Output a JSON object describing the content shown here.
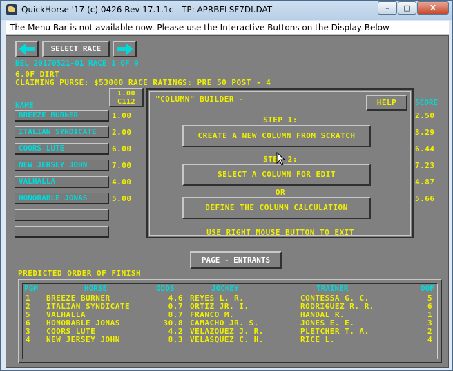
{
  "window": {
    "title": "QuickHorse '17 (c) 0426 Rev 17.1.1c - TP: APRBELSF7DI.DAT",
    "minimize_label": "–",
    "maximize_label": "□",
    "close_label": "X"
  },
  "menu_bar_text": "The Menu Bar is not available now.  Please use the Interactive Buttons on the Display Below",
  "nav": {
    "select_race_label": "SELECT RACE"
  },
  "race_info": {
    "line1": "BEL 20170521-01 RACE 1 OF 9",
    "line2": "6.0F DIRT",
    "line3": "CLAIMING PURSE: $53000  RACE RATINGS: PRE 50  POST - 4"
  },
  "column_header": {
    "top": "1.00",
    "bottom": "C112"
  },
  "name_header": "NAME",
  "score_header": "SCORE",
  "entrants": [
    {
      "name": "BREEZE BURNER",
      "value": "1.00",
      "score": "2.50"
    },
    {
      "name": "ITALIAN SYNDICATE",
      "value": "2.00",
      "score": "3.29"
    },
    {
      "name": "COORS LUTE",
      "value": "6.00",
      "score": "6.44"
    },
    {
      "name": "NEW JERSEY JOHN",
      "value": "7.00",
      "score": "7.23"
    },
    {
      "name": "VALHALLA",
      "value": "4.00",
      "score": "4.87"
    },
    {
      "name": "HONORABLE JONAS",
      "value": "5.00",
      "score": "5.66"
    }
  ],
  "builder": {
    "title": "\"COLUMN\" BUILDER -",
    "help_label": "HELP",
    "step1": "STEP 1:",
    "create_label": "CREATE A NEW COLUMN FROM SCRATCH",
    "step2": "STEP 2:",
    "select_label": "SELECT A COLUMN FOR EDIT",
    "or_label": "OR",
    "define_label": "DEFINE THE COLUMN CALCULATION",
    "exit_hint": "USE RIGHT MOUSE BUTTON TO EXIT"
  },
  "page_button_label": "PAGE - ENTRANTS",
  "predicted_title": "PREDICTED ORDER OF FINISH",
  "predicted": {
    "headers": {
      "pgm": "PGM",
      "horse": "HORSE",
      "odds": "ODDS",
      "jockey": "JOCKEY",
      "trainer": "TRAINER",
      "oof": "OOF"
    },
    "rows": [
      {
        "pgm": "1",
        "horse": "BREEZE BURNER",
        "odds": "4.6",
        "jockey": "REYES L. R.",
        "trainer": "CONTESSA G. C.",
        "oof": "5"
      },
      {
        "pgm": "2",
        "horse": "ITALIAN SYNDICATE",
        "odds": "0.7",
        "jockey": "ORTIZ JR. I.",
        "trainer": "RODRIGUEZ R. R.",
        "oof": "6"
      },
      {
        "pgm": "5",
        "horse": "VALHALLA",
        "odds": "8.7",
        "jockey": "FRANCO M.",
        "trainer": "HANDAL R.",
        "oof": "1"
      },
      {
        "pgm": "6",
        "horse": "HONORABLE JONAS",
        "odds": "30.8",
        "jockey": "CAMACHO JR. S.",
        "trainer": "JONES E. E.",
        "oof": "3"
      },
      {
        "pgm": "3",
        "horse": "COORS LUTE",
        "odds": "4.2",
        "jockey": "VELAZQUEZ J. R.",
        "trainer": "PLETCHER T. A.",
        "oof": "2"
      },
      {
        "pgm": "4",
        "horse": "NEW JERSEY JOHN",
        "odds": "8.3",
        "jockey": "VELASQUEZ C. H.",
        "trainer": "RICE L.",
        "oof": "4"
      }
    ]
  },
  "colors": {
    "yellow": "#f0f000",
    "cyan": "#00dada",
    "panel": "#808080"
  }
}
